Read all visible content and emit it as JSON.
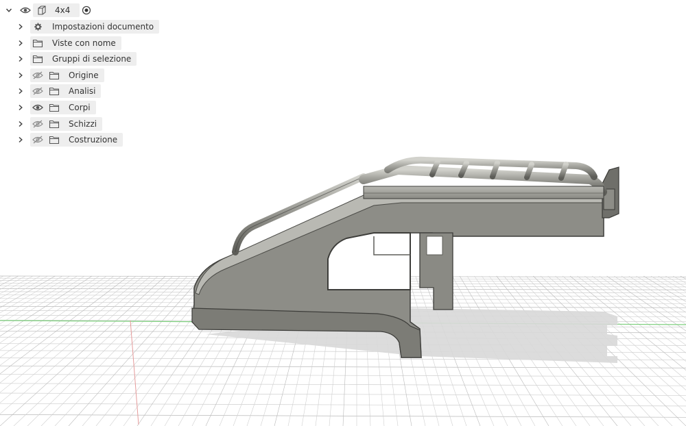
{
  "browser": {
    "root": {
      "label": "4x4",
      "visibility_icon": "eye-icon",
      "component_icon": "component-box-icon",
      "active_icon": "radio-active-icon"
    },
    "items": [
      {
        "label": "Impostazioni documento",
        "icon": "gear-icon",
        "visibility": null
      },
      {
        "label": "Viste con nome",
        "icon": "folder-icon",
        "visibility": null
      },
      {
        "label": "Gruppi di selezione",
        "icon": "folder-icon",
        "visibility": null
      },
      {
        "label": "Origine",
        "icon": "folder-icon",
        "visibility": "eye-hidden-icon"
      },
      {
        "label": "Analisi",
        "icon": "folder-icon",
        "visibility": "eye-hidden-icon"
      },
      {
        "label": "Corpi",
        "icon": "folder-icon",
        "visibility": "eye-icon"
      },
      {
        "label": "Schizzi",
        "icon": "folder-icon",
        "visibility": "eye-hidden-icon"
      },
      {
        "label": "Costruzione",
        "icon": "folder-icon",
        "visibility": "eye-hidden-icon"
      }
    ]
  },
  "colors": {
    "grid_line": "#cfcfcf",
    "grid_major": "#b9b9b9",
    "axis_green": "#7ccf7c",
    "axis_red": "#e59a9a",
    "body_fill": "#8c8c86",
    "body_dark": "#5f5f5a",
    "body_light": "#a9a9a3",
    "shadow": "#d6d6d6"
  }
}
